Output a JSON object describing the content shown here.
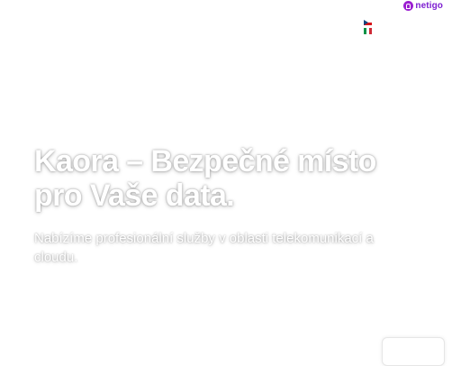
{
  "header": {
    "brand_name": "netigo",
    "brand_icon": "netigo-logo-icon",
    "brand_color": "#9b1fd1",
    "languages": [
      {
        "code": "cs",
        "icon": "flag-cz-icon"
      },
      {
        "code": "it",
        "icon": "flag-it-icon"
      }
    ]
  },
  "hero": {
    "title": "Kaora – Bezpečné místo pro Vaše data.",
    "subtitle": "Nabízíme profesionální služby v oblasti telekomunikací a cloudu.",
    "text_color": "#ffffff"
  }
}
